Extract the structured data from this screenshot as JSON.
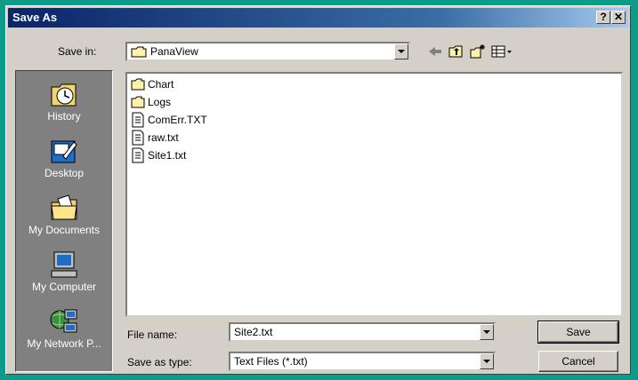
{
  "window": {
    "title": "Save As"
  },
  "titlebar_buttons": {
    "help": "?",
    "close": "✕"
  },
  "save_in": {
    "label": "Save in:",
    "value": "PanaView"
  },
  "places": [
    {
      "label": "History",
      "icon": "history-icon"
    },
    {
      "label": "Desktop",
      "icon": "desktop-icon"
    },
    {
      "label": "My Documents",
      "icon": "my-documents-icon"
    },
    {
      "label": "My Computer",
      "icon": "my-computer-icon"
    },
    {
      "label": "My Network P...",
      "icon": "network-places-icon"
    }
  ],
  "files": [
    {
      "name": "Chart",
      "type": "folder"
    },
    {
      "name": "Logs",
      "type": "folder"
    },
    {
      "name": "ComErr.TXT",
      "type": "text"
    },
    {
      "name": "raw.txt",
      "type": "text"
    },
    {
      "name": "Site1.txt",
      "type": "text"
    }
  ],
  "file_name": {
    "label": "File name:",
    "value": "Site2.txt"
  },
  "save_type": {
    "label": "Save as type:",
    "value": "Text Files (*.txt)"
  },
  "buttons": {
    "save": "Save",
    "cancel": "Cancel"
  }
}
